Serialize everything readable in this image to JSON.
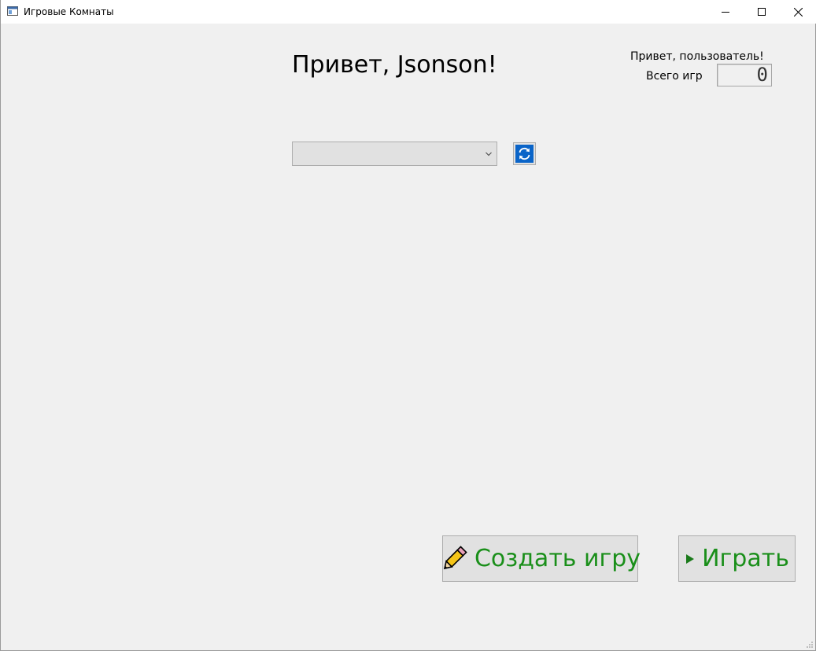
{
  "window": {
    "title": "Игровые Комнаты",
    "icon": "app-window-icon",
    "controls": [
      "minimize-icon",
      "maximize-icon",
      "close-icon"
    ]
  },
  "main": {
    "greeting": "Привет, Jsonson!",
    "hello_user": "Привет, пользователь!",
    "games_total_label": "Всего игр",
    "games_total_value": "0",
    "room_select": {
      "selected": "",
      "icon": "chevron-down-icon"
    },
    "refresh_icon": "refresh-icon"
  },
  "actions": {
    "create_game": {
      "label": "Создать игру",
      "icon": "pencil-icon"
    },
    "play": {
      "label": "Играть",
      "icon": "play-icon"
    }
  },
  "colors": {
    "background": "#f0f0f0",
    "button_text_green": "#1a8f1a",
    "refresh_blue": "#0a64c8"
  }
}
